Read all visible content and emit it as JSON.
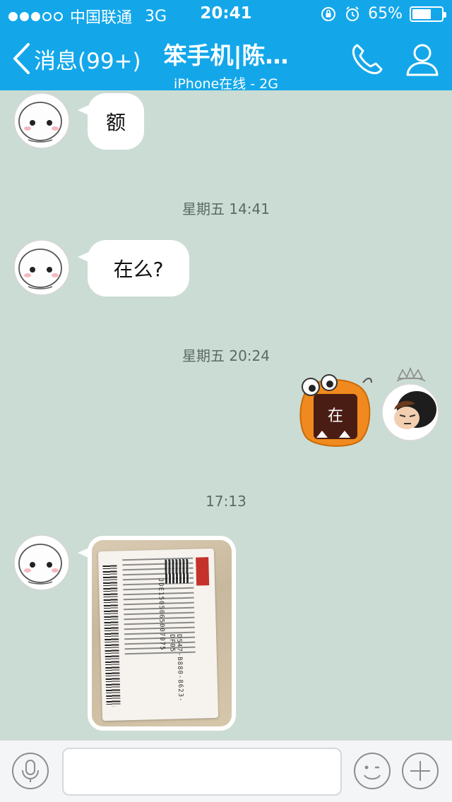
{
  "status_bar": {
    "carrier": "中国联通",
    "network": "3G",
    "time": "20:41",
    "battery": "65%",
    "battery_level": 0.65,
    "signal_bars_filled": 3,
    "signal_bars_total": 5
  },
  "nav": {
    "back_label": "消息(99+)",
    "title": "笨手机|陈…",
    "subtitle": "iPhone在线 - 2G"
  },
  "chat": {
    "messages": [
      {
        "type": "incoming_text",
        "text": "额"
      },
      {
        "type": "timestamp",
        "text": "星期五 14:41"
      },
      {
        "type": "incoming_text",
        "text": "在么?"
      },
      {
        "type": "timestamp",
        "text": "星期五 20:24"
      },
      {
        "type": "outgoing_sticker",
        "text": "在"
      },
      {
        "type": "timestamp",
        "text": "17:13"
      },
      {
        "type": "incoming_image"
      }
    ],
    "image_card": {
      "code": "JDE1505065007075",
      "pin": "D547-B880-8623-DF05"
    }
  },
  "colors": {
    "accent": "#13a7ea",
    "chat_background": "#cbdcd4",
    "bubble": "#ffffff",
    "sticker_orange": "#f08a1e"
  },
  "input_bar": {
    "placeholder": "",
    "icons": [
      "microphone-icon",
      "emoji-icon",
      "plus-icon"
    ]
  }
}
